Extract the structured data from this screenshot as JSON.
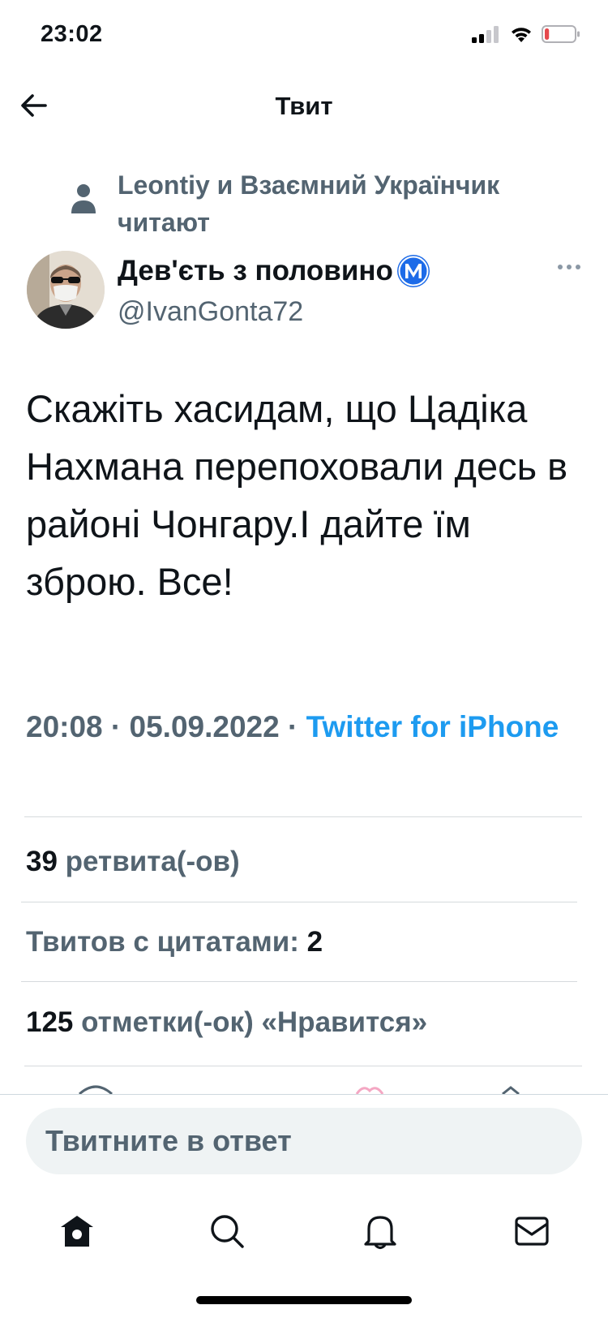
{
  "status_bar": {
    "time": "23:02",
    "battery_level": 0.15,
    "battery_color": "#e5484d"
  },
  "header": {
    "title": "Твит",
    "back_icon": "arrow-left-icon"
  },
  "social_context": {
    "text": "Leontiy и Взаємний Українчик читают",
    "icon": "person-icon"
  },
  "author": {
    "name": "Дев'єть з половино",
    "badge": "Ⓜ️",
    "handle": "@IvanGonta72",
    "badge_color": "#1d6be8"
  },
  "tweet": {
    "text": "Скажіть хасидам, що Цадіка Нахмана перепоховали десь в районі Чонгару.І дайте їм зброю. Все!",
    "time": "20:08",
    "date": "05.09.2022",
    "separator": "·",
    "source": "Twitter for iPhone"
  },
  "stats": {
    "retweets_count": "39",
    "retweets_label": "ретвита(-ов)",
    "quotes_label": "Твитов с цитатами:",
    "quotes_count": "2",
    "likes_count": "125",
    "likes_label": "отметки(-ок) «Нравится»"
  },
  "reply": {
    "placeholder": "Твитните в ответ"
  },
  "tabs": [
    "home-icon",
    "search-icon",
    "bell-icon",
    "mail-icon"
  ],
  "colors": {
    "accent": "#1d9bf0",
    "secondary_text": "#536471",
    "divider": "#d6dadd"
  }
}
